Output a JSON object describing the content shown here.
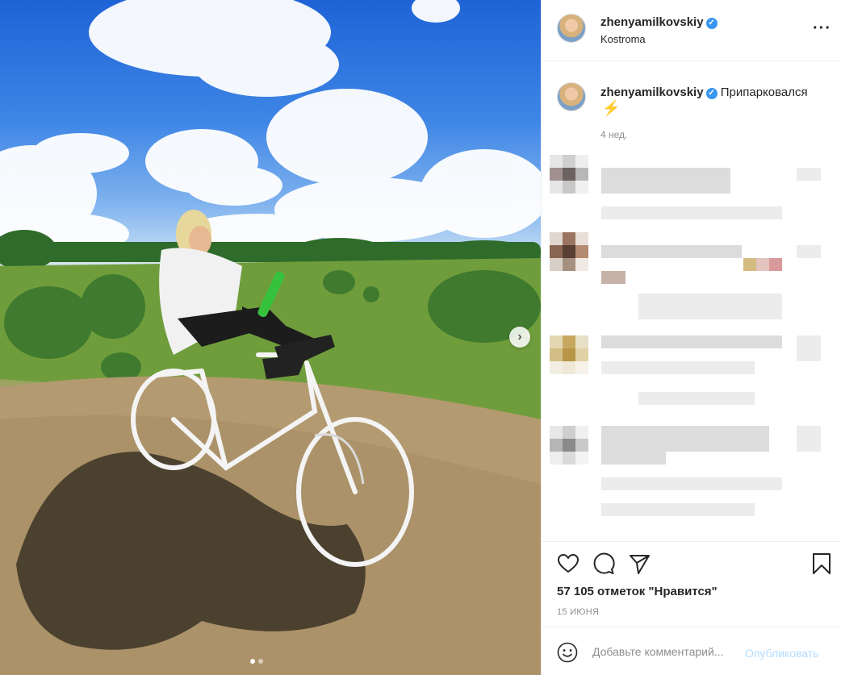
{
  "post": {
    "username": "zhenyamilkovskiy",
    "verified_icon": "verified-badge-icon",
    "location": "Kostroma",
    "more_icon": "more-options-icon",
    "caption_text": "Припарковался",
    "caption_emoji": "⚡",
    "caption_time": "4 нед.",
    "likes_text": "57 105 отметок \"Нравится\"",
    "date": "15 ИЮНЯ"
  },
  "photo": {
    "description_icon": "photo",
    "next_icon": "chevron-right-icon",
    "slides": 2,
    "active_slide": 1
  },
  "actions": {
    "like_icon": "heart-icon",
    "comment_icon": "comment-icon",
    "share_icon": "send-icon",
    "save_icon": "bookmark-icon"
  },
  "comment_box": {
    "emoji_icon": "emoji-icon",
    "placeholder": "Добавьте комментарий...",
    "publish_label": "Опубликовать"
  },
  "colors": {
    "link_blue_disabled": "#b3dbff",
    "verified_blue": "#3897f0",
    "text_primary": "#262626",
    "text_secondary": "#8e8e8e",
    "border": "#efefef"
  }
}
